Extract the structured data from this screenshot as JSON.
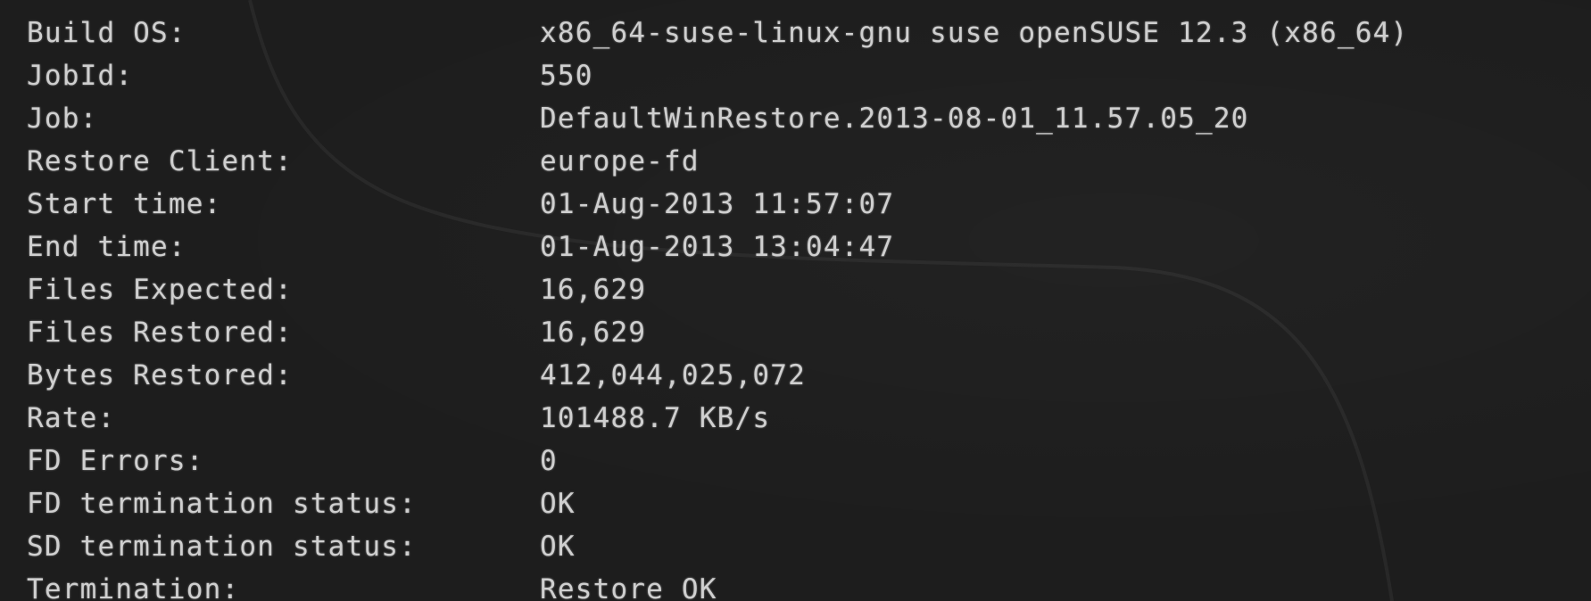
{
  "report": {
    "rows": [
      {
        "key": "Build OS:",
        "value": "x86_64-suse-linux-gnu suse openSUSE 12.3 (x86_64)"
      },
      {
        "key": "JobId:",
        "value": "550"
      },
      {
        "key": "Job:",
        "value": "DefaultWinRestore.2013-08-01_11.57.05_20"
      },
      {
        "key": "Restore Client:",
        "value": "europe-fd"
      },
      {
        "key": "Start time:",
        "value": "01-Aug-2013 11:57:07"
      },
      {
        "key": "End time:",
        "value": "01-Aug-2013 13:04:47"
      },
      {
        "key": "Files Expected:",
        "value": "16,629"
      },
      {
        "key": "Files Restored:",
        "value": "16,629"
      },
      {
        "key": "Bytes Restored:",
        "value": "412,044,025,072"
      },
      {
        "key": "Rate:",
        "value": "101488.7 KB/s"
      },
      {
        "key": "FD Errors:",
        "value": "0"
      },
      {
        "key": "FD termination status:",
        "value": "OK"
      },
      {
        "key": "SD termination status:",
        "value": "OK"
      },
      {
        "key": "Termination:",
        "value": "Restore OK"
      }
    ]
  },
  "colors": {
    "background": "#1d1d1d",
    "text": "#cfcfcf"
  }
}
